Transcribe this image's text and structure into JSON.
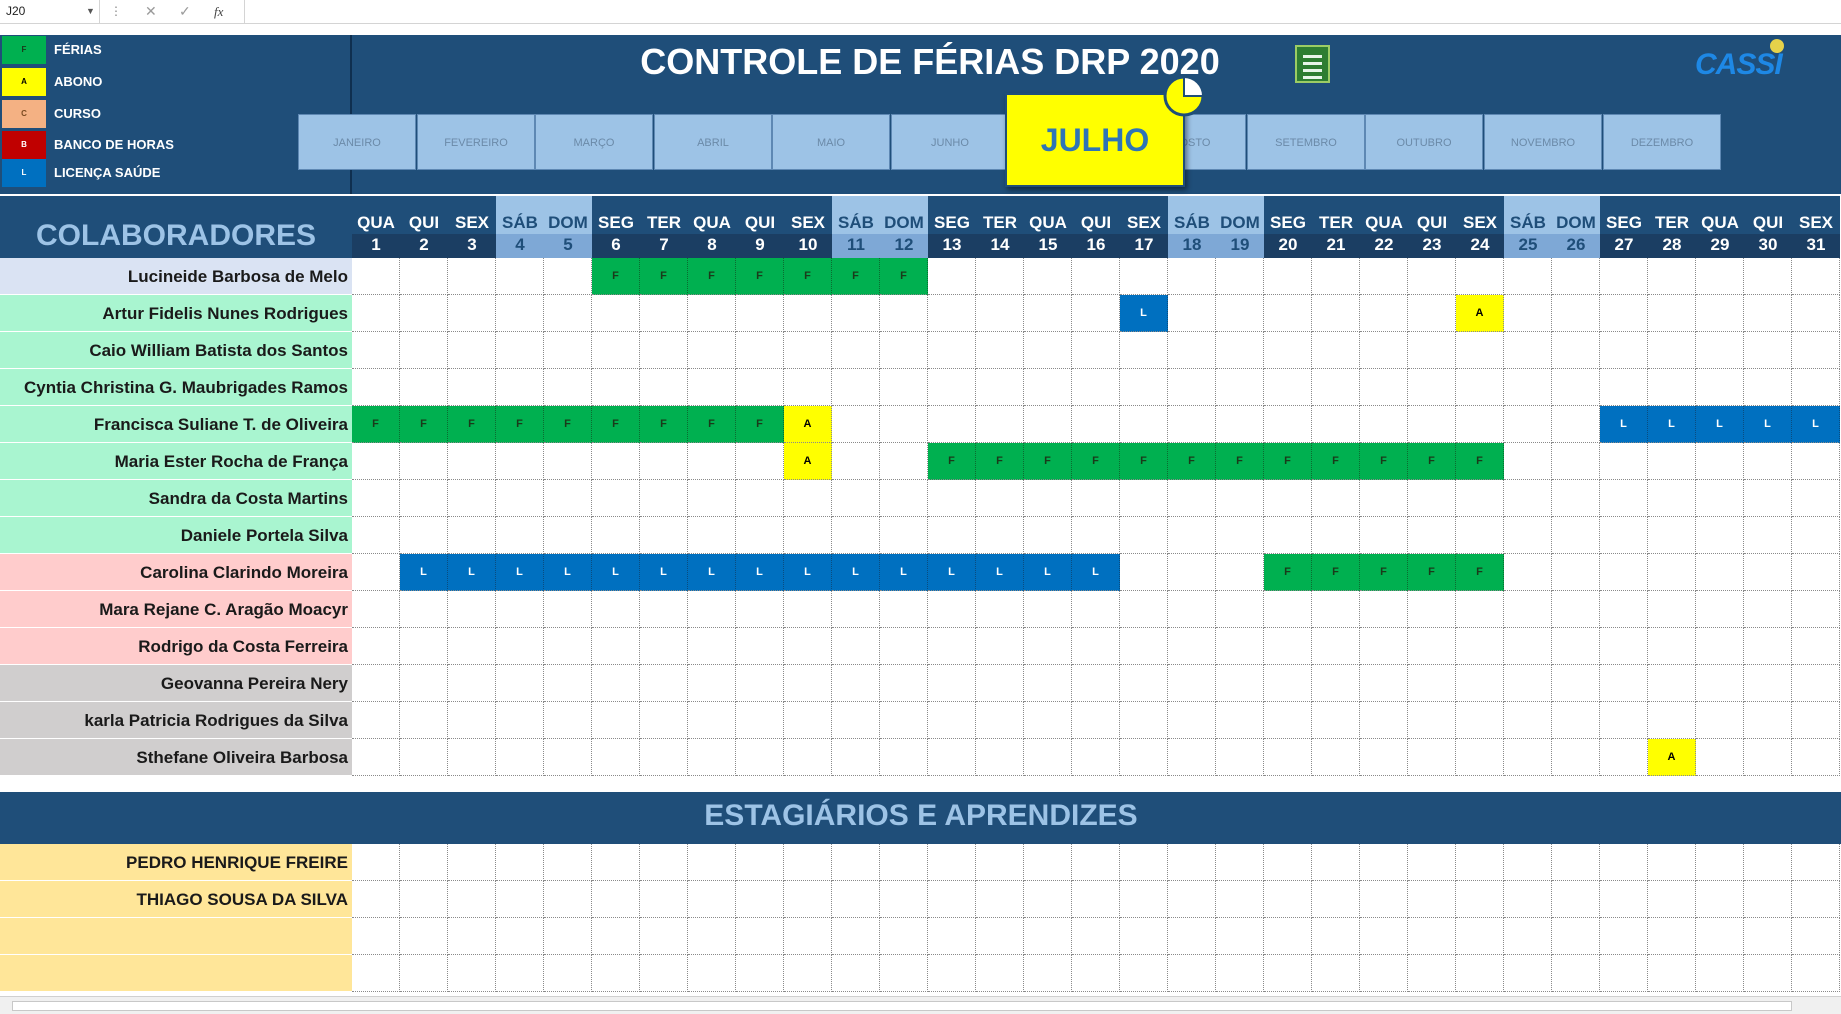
{
  "formula_bar": {
    "cell_ref": "J20",
    "fx_label": "fx",
    "formula": ""
  },
  "legend": [
    {
      "code": "F",
      "label": "FÉRIAS",
      "color": "#00b050",
      "text_color": "#1a3a1a"
    },
    {
      "code": "A",
      "label": "ABONO",
      "color": "#ffff00",
      "text_color": "#000000"
    },
    {
      "code": "C",
      "label": "CURSO",
      "color": "#f4b183",
      "text_color": "#7a4a20"
    },
    {
      "code": "B",
      "label": "BANCO DE HORAS",
      "color": "#c00000",
      "text_color": "#ffffff"
    },
    {
      "code": "L",
      "label": "LICENÇA SAÚDE",
      "color": "#0070c0",
      "text_color": "#ffffff"
    }
  ],
  "title": "CONTROLE DE FÉRIAS DRP 2020",
  "logo": "CASSI",
  "months": [
    "JANEIRO",
    "FEVEREIRO",
    "MARÇO",
    "ABRIL",
    "MAIO",
    "JUNHO",
    "JULHO",
    "AGOSTO",
    "SETEMBRO",
    "OUTUBRO",
    "NOVEMBRO",
    "DEZEMBRO"
  ],
  "selected_month": "JULHO",
  "colaboradores_title": "COLABORADORES",
  "days": [
    {
      "dow": "QUA",
      "day": "1"
    },
    {
      "dow": "QUI",
      "day": "2"
    },
    {
      "dow": "SEX",
      "day": "3"
    },
    {
      "dow": "SÁB",
      "day": "4",
      "weekend": true
    },
    {
      "dow": "DOM",
      "day": "5",
      "weekend": true
    },
    {
      "dow": "SEG",
      "day": "6"
    },
    {
      "dow": "TER",
      "day": "7"
    },
    {
      "dow": "QUA",
      "day": "8"
    },
    {
      "dow": "QUI",
      "day": "9"
    },
    {
      "dow": "SEX",
      "day": "10"
    },
    {
      "dow": "SÁB",
      "day": "11",
      "weekend": true
    },
    {
      "dow": "DOM",
      "day": "12",
      "weekend": true
    },
    {
      "dow": "SEG",
      "day": "13"
    },
    {
      "dow": "TER",
      "day": "14"
    },
    {
      "dow": "QUA",
      "day": "15"
    },
    {
      "dow": "QUI",
      "day": "16"
    },
    {
      "dow": "SEX",
      "day": "17"
    },
    {
      "dow": "SÁB",
      "day": "18",
      "weekend": true
    },
    {
      "dow": "DOM",
      "day": "19",
      "weekend": true
    },
    {
      "dow": "SEG",
      "day": "20"
    },
    {
      "dow": "TER",
      "day": "21"
    },
    {
      "dow": "QUA",
      "day": "22"
    },
    {
      "dow": "QUI",
      "day": "23"
    },
    {
      "dow": "SEX",
      "day": "24"
    },
    {
      "dow": "SÁB",
      "day": "25",
      "weekend": true
    },
    {
      "dow": "DOM",
      "day": "26",
      "weekend": true
    },
    {
      "dow": "SEG",
      "day": "27"
    },
    {
      "dow": "TER",
      "day": "28"
    },
    {
      "dow": "QUA",
      "day": "29"
    },
    {
      "dow": "QUI",
      "day": "30"
    },
    {
      "dow": "SEX",
      "day": "31"
    }
  ],
  "employees": [
    {
      "name": "Lucineide Barbosa de Melo",
      "group_color": "#dae3f3",
      "marks": {
        "6": "F",
        "7": "F",
        "8": "F",
        "9": "F",
        "10": "F",
        "11": "F",
        "12": "F"
      }
    },
    {
      "name": "Artur Fidelis Nunes Rodrigues",
      "group_color": "#a9f5d0",
      "marks": {
        "17": "L",
        "24": "A"
      }
    },
    {
      "name": "Caio William Batista dos Santos",
      "group_color": "#a9f5d0",
      "marks": {}
    },
    {
      "name": "Cyntia Christina G. Maubrigades Ramos",
      "group_color": "#a9f5d0",
      "marks": {}
    },
    {
      "name": "Francisca Suliane T. de Oliveira",
      "group_color": "#a9f5d0",
      "marks": {
        "1": "F",
        "2": "F",
        "3": "F",
        "4": "F",
        "5": "F",
        "6": "F",
        "7": "F",
        "8": "F",
        "9": "F",
        "10": "A",
        "27": "L",
        "28": "L",
        "29": "L",
        "30": "L",
        "31": "L"
      }
    },
    {
      "name": "Maria Ester Rocha de França",
      "group_color": "#a9f5d0",
      "marks": {
        "10": "A",
        "13": "F",
        "14": "F",
        "15": "F",
        "16": "F",
        "17": "F",
        "18": "F",
        "19": "F",
        "20": "F",
        "21": "F",
        "22": "F",
        "23": "F",
        "24": "F"
      }
    },
    {
      "name": "Sandra da Costa Martins",
      "group_color": "#a9f5d0",
      "marks": {}
    },
    {
      "name": "Daniele Portela Silva",
      "group_color": "#a9f5d0",
      "marks": {}
    },
    {
      "name": "Carolina Clarindo Moreira",
      "group_color": "#ffcccc",
      "marks": {
        "2": "L",
        "3": "L",
        "4": "L",
        "5": "L",
        "6": "L",
        "7": "L",
        "8": "L",
        "9": "L",
        "10": "L",
        "11": "L",
        "12": "L",
        "13": "L",
        "14": "L",
        "15": "L",
        "16": "L",
        "20": "F",
        "21": "F",
        "22": "F",
        "23": "F",
        "24": "F"
      }
    },
    {
      "name": "Mara Rejane C. Aragão Moacyr",
      "group_color": "#ffcccc",
      "marks": {}
    },
    {
      "name": "Rodrigo da Costa Ferreira",
      "group_color": "#ffcccc",
      "marks": {}
    },
    {
      "name": "Geovanna Pereira Nery",
      "group_color": "#d0cece",
      "marks": {}
    },
    {
      "name": "karla Patricia Rodrigues da Silva",
      "group_color": "#d0cece",
      "marks": {}
    },
    {
      "name": "Sthefane Oliveira Barbosa",
      "group_color": "#d0cece",
      "marks": {
        "28": "A"
      }
    }
  ],
  "estagiarios_title": "ESTAGIÁRIOS E APRENDIZES",
  "interns": [
    {
      "name": "PEDRO HENRIQUE FREIRE",
      "marks": {}
    },
    {
      "name": "THIAGO SOUSA DA SILVA",
      "marks": {}
    },
    {
      "name": "",
      "marks": {}
    },
    {
      "name": "",
      "marks": {}
    }
  ],
  "intern_group_color": "#ffe699"
}
